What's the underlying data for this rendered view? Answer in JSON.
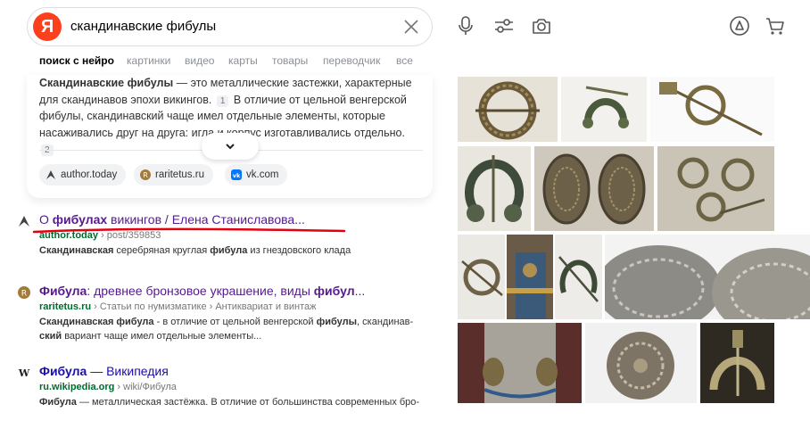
{
  "header": {
    "query": "скандинавские фибулы",
    "logo_letter": "Я"
  },
  "tabs": [
    {
      "label": "поиск с нейро",
      "active": true
    },
    {
      "label": "картинки"
    },
    {
      "label": "видео"
    },
    {
      "label": "карты"
    },
    {
      "label": "товары"
    },
    {
      "label": "переводчик"
    },
    {
      "label": "все"
    }
  ],
  "snippet": {
    "bold_lead": "Скандинавские фибулы",
    "text_1": " — это металлические застежки, характерные для скандинавов эпохи викингов.",
    "ref_1": "1",
    "text_2": " В отличие от цельной венгерской фибулы, скандинавский чаще имел отдельные элементы, которые насаживались друг на друга: игла и корпус изготавливались отдельно.",
    "ref_2": "2",
    "sources": [
      {
        "label": "author.today",
        "icon": "author-today-icon"
      },
      {
        "label": "raritetus.ru",
        "icon": "raritetus-icon"
      },
      {
        "label": "vk.com",
        "icon": "vk-icon"
      }
    ]
  },
  "results": [
    {
      "title_pre": "О ",
      "title_bold": "фибулах",
      "title_post": " викингов / Елена Станиславова...",
      "host": "author.today",
      "path": " › post/359853",
      "snippet_bold": "Скандинавская",
      "snippet_mid": " серебряная круглая ",
      "snippet_bold2": "фибула",
      "snippet_post": " из гнездовского клада"
    },
    {
      "title_bold": "Фибула",
      "title_post": ": древнее бронзовое украшение, виды ",
      "title_bold2": "фибул",
      "title_end": "...",
      "host": "raritetus.ru",
      "path": " › Статьи по нумизматике › Антиквариат и винтаж",
      "snippet_bold": "Скандинавская фибула",
      "snippet_mid": " - в отличие от цельной венгерской ",
      "snippet_bold2": "фибулы",
      "snippet_mid2": ", скандинав-",
      "snippet_bold3": "ский",
      "snippet_post": " вариант чаще имел отдельные элементы..."
    },
    {
      "title_bold": "Фибула",
      "title_post": " — Википедия",
      "host": "ru.wikipedia.org",
      "path": " › wiki/Фибула",
      "snippet_bold": "Фибула",
      "snippet_post": " — металлическая застёжка. В отличие от большинства современных бро-"
    }
  ],
  "colors": {
    "accent_red": "#fc3f1d",
    "visited_link": "#551a8b",
    "link": "#1a0dab",
    "url_green": "#006b2d",
    "underline_red": "#e3000f"
  }
}
